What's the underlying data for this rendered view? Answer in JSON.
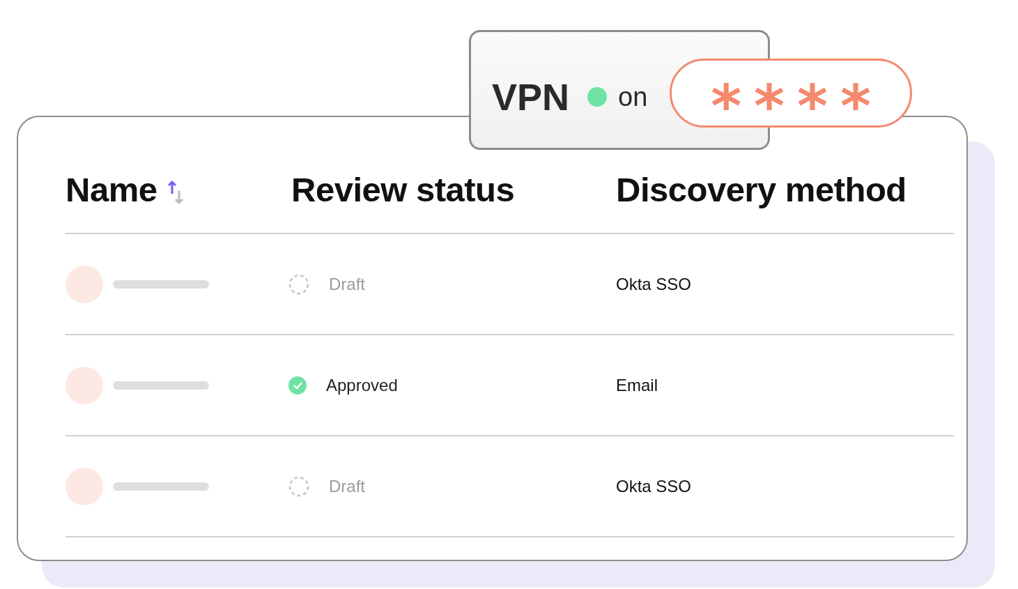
{
  "vpn_card": {
    "title": "VPN",
    "on": true,
    "status": "on",
    "password": "****"
  },
  "table": {
    "columns": [
      {
        "label": "Name",
        "sortable": true,
        "sort_ascending": true
      },
      {
        "label": "Review status",
        "sortable": false
      },
      {
        "label": "Discovery method",
        "sortable": false
      }
    ],
    "rows": [
      {
        "status": "Draft",
        "approved": false,
        "method": "Okta SSO"
      },
      {
        "status": "Approved",
        "approved": true,
        "method": "Email"
      },
      {
        "status": "Draft",
        "approved": false,
        "method": "Okta SSO"
      }
    ]
  }
}
